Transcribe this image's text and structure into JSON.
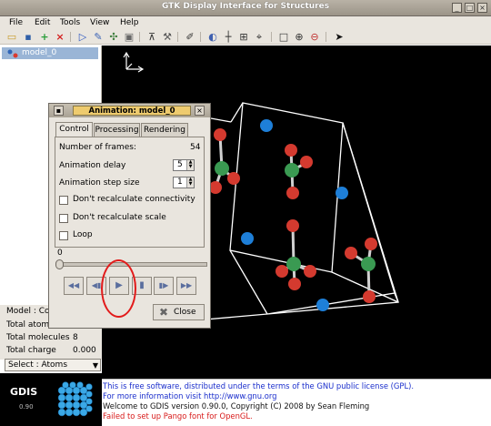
{
  "window": {
    "title": "GTK Display Interface for Structures",
    "controls": [
      "_",
      "□",
      "×"
    ]
  },
  "menu": [
    "File",
    "Edit",
    "Tools",
    "View",
    "Help"
  ],
  "toolbar_icons": [
    "open-icon",
    "save-icon",
    "add-icon",
    "delete-icon",
    "play-icon",
    "edit-icon",
    "measure-icon",
    "surface-icon",
    "iso-icon",
    "dynamics-icon",
    "pencil-icon",
    "axis-icon",
    "plane-icon",
    "grid-icon",
    "camera-icon",
    "frame-icon",
    "plus-icon",
    "minus-icon",
    "pointer-icon"
  ],
  "model_tree": {
    "items": [
      {
        "label": "model_0",
        "selected": true
      }
    ]
  },
  "info": {
    "model_label": "Model : Co",
    "rows": [
      {
        "label": "Total atom",
        "value": ""
      },
      {
        "label": "Total molecules",
        "value": "8"
      },
      {
        "label": "Total charge",
        "value": "0.000"
      }
    ]
  },
  "select": {
    "value": "Select : Atoms"
  },
  "logo": {
    "text": "GDIS",
    "version": "0.90"
  },
  "status": {
    "lines": [
      {
        "text": "This is free software, distributed under the terms of the GNU public license (GPL).",
        "color": "#1a2ecc"
      },
      {
        "text": "For more information visit http://www.gnu.org",
        "color": "#1a2ecc"
      },
      {
        "text": "Welcome to GDIS version 0.90.0, Copyright (C) 2008 by Sean Fleming",
        "color": "#111111"
      },
      {
        "text": "Failed to set up Pango font for OpenGL.",
        "color": "#d81a1a"
      }
    ]
  },
  "dialog": {
    "title": "Animation: model_0",
    "tabs": [
      "Control",
      "Processing",
      "Rendering"
    ],
    "active_tab": 0,
    "frames_label": "Number of frames:",
    "frames_value": "54",
    "delay_label": "Animation delay",
    "delay_value": "5",
    "step_label": "Animation step size",
    "step_value": "1",
    "checkboxes": [
      {
        "label": "Don't recalculate connectivity",
        "checked": false
      },
      {
        "label": "Don't recalculate scale",
        "checked": false
      },
      {
        "label": "Loop",
        "checked": false
      }
    ],
    "frame_label": "0",
    "frame_slider": 0,
    "playback": [
      {
        "name": "rewind-button",
        "icon": "rewind-icon",
        "glyph": "◀◀"
      },
      {
        "name": "step-back-button",
        "icon": "step-back-icon",
        "glyph": "◀▮"
      },
      {
        "name": "play-button",
        "icon": "play-icon",
        "glyph": "▶"
      },
      {
        "name": "stop-button",
        "icon": "stop-icon",
        "glyph": "▮"
      },
      {
        "name": "step-forward-button",
        "icon": "step-forward-icon",
        "glyph": "▮▶"
      },
      {
        "name": "fast-forward-button",
        "icon": "fast-forward-icon",
        "glyph": "▶▶"
      }
    ],
    "close_label": "Close"
  },
  "colors": {
    "oxygen": "#d9392e",
    "hydrogen": "#3b9a52",
    "ion": "#1e7fd8",
    "highlight": "#e21b1b"
  }
}
